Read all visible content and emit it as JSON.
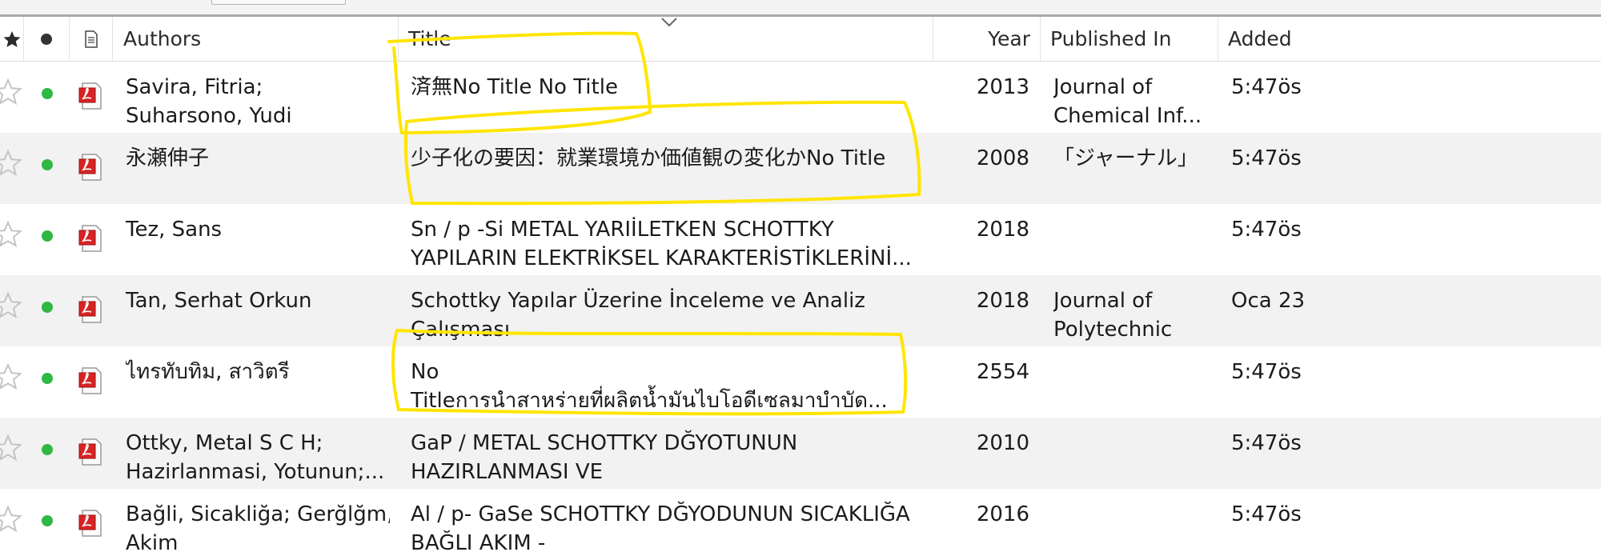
{
  "header": {
    "authors": "Authors",
    "title": "Title",
    "year": "Year",
    "published_in": "Published In",
    "added": "Added"
  },
  "rows": [
    {
      "authors": [
        "Savira, Fitria;",
        "Suharsono, Yudi"
      ],
      "title": [
        "済無No Title No Title"
      ],
      "year": "2013",
      "published_in": [
        "Journal of",
        "Chemical Inf..."
      ],
      "added": "5:47ös"
    },
    {
      "authors": [
        "永瀬伸子"
      ],
      "title": [
        "少子化の要因：就業環境か価値観の変化かNo Title"
      ],
      "year": "2008",
      "published_in": [
        "「ジャーナル」"
      ],
      "added": "5:47ös"
    },
    {
      "authors": [
        "Tez, Sans"
      ],
      "title": [
        "Sn / p -Si METAL YARIİLETKEN SCHOTTKY",
        "YAPILARIN ELEKTRİKSEL KARAKTERİSTİKLERİNİ..."
      ],
      "year": "2018",
      "published_in": [],
      "added": "5:47ös"
    },
    {
      "authors": [
        "Tan, Serhat Orkun"
      ],
      "title": [
        "Schottky Yapılar Üzerine İnceleme ve Analiz",
        "Çalışması"
      ],
      "year": "2018",
      "published_in": [
        "Journal of",
        "Polytechnic"
      ],
      "added": "Oca 23"
    },
    {
      "authors": [
        "ไทรทับทิม, สาวิตรี"
      ],
      "title": [
        "No",
        "Titleการนำสาหร่ายที่ผลิตน้ำมันไบโอดีเซลมาบำบัด..."
      ],
      "year": "2554",
      "published_in": [],
      "added": "5:47ös"
    },
    {
      "authors": [
        "Ottky, Metal S C H;",
        "Hazirlanmasi, Yotunun;..."
      ],
      "title": [
        "GaP / METAL SCHOTTKY DĞYOTUNUN",
        "HAZIRLANMASI VE"
      ],
      "year": "2010",
      "published_in": [],
      "added": "5:47ös"
    },
    {
      "authors": [
        "Bağli, Sicakliğa; Gerğlğm,",
        "Akim"
      ],
      "title": [
        "Al / p- GaSe SCHOTTKY DĞYODUNUN SICAKLIĞA",
        "BAĞLI AKIM -"
      ],
      "year": "2016",
      "published_in": [],
      "added": "5:47ös"
    }
  ],
  "colors": {
    "read_dot": "#2fb843",
    "highlight": "#ffe500",
    "alt_row": "#f2f2f2"
  }
}
